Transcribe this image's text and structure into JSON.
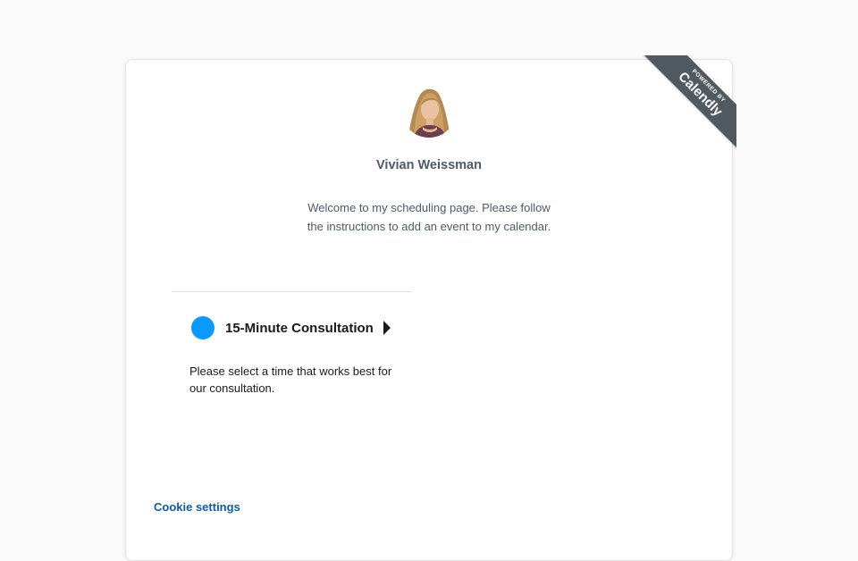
{
  "branding": {
    "powered_by": "POWERED BY",
    "brand": "Calendly",
    "ribbon_color": "#505a60"
  },
  "host": {
    "name": "Vivian Weissman",
    "avatar_icon": "profile-photo"
  },
  "welcome_message": "Welcome to my scheduling page. Please follow the instructions to add an event to my calendar.",
  "events": [
    {
      "title": "15-Minute Consultation",
      "description": "Please select a time that works best for our consultation.",
      "color": "#0a99ff",
      "arrow_icon": "triangle-right-icon"
    }
  ],
  "footer": {
    "cookie_settings": "Cookie settings",
    "link_color": "#0b5cad"
  }
}
